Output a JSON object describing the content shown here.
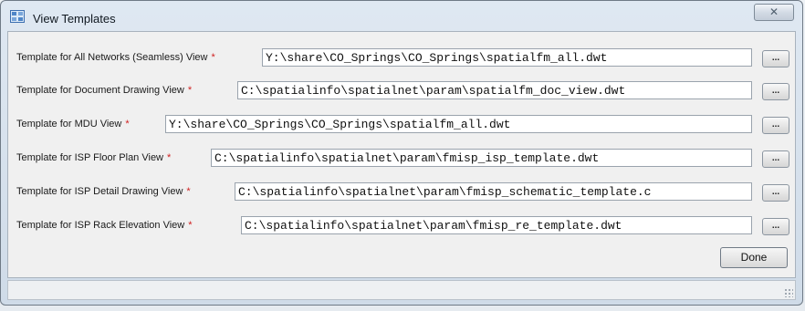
{
  "window": {
    "title": "View Templates",
    "close_label": "✕",
    "icon": "view-templates-app-icon"
  },
  "rows": [
    {
      "label": "Template for All Networks (Seamless) View",
      "required_marker": "*",
      "value": "Y:\\share\\CO_Springs\\CO_Springs\\spatialfm_all.dwt",
      "browse_label": "..."
    },
    {
      "label": "Template for Document Drawing View",
      "required_marker": "*",
      "value": "C:\\spatialinfo\\spatialnet\\param\\spatialfm_doc_view.dwt",
      "browse_label": "..."
    },
    {
      "label": "Template for MDU View",
      "required_marker": "*",
      "value": "Y:\\share\\CO_Springs\\CO_Springs\\spatialfm_all.dwt",
      "browse_label": "..."
    },
    {
      "label": "Template for ISP Floor Plan View",
      "required_marker": "*",
      "value": "C:\\spatialinfo\\spatialnet\\param\\fmisp_isp_template.dwt",
      "browse_label": "..."
    },
    {
      "label": "Template for ISP Detail Drawing View",
      "required_marker": "*",
      "value": "C:\\spatialinfo\\spatialnet\\param\\fmisp_schematic_template.c",
      "browse_label": "..."
    },
    {
      "label": "Template for ISP Rack Elevation View",
      "required_marker": "*",
      "value": "C:\\spatialinfo\\spatialnet\\param\\fmisp_re_template.dwt",
      "browse_label": "..."
    }
  ],
  "footer": {
    "done_label": "Done"
  },
  "colors": {
    "required": "#d02020",
    "title_bar": "#dfe8f2"
  }
}
